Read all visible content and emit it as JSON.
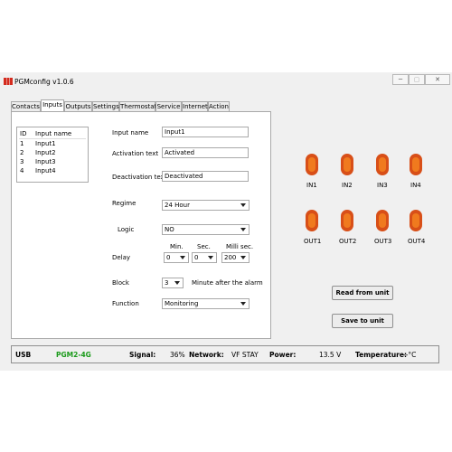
{
  "window": {
    "title": "PGMconfig v1.0.6"
  },
  "tabs": [
    "Contacts",
    "Inputs",
    "Outputs",
    "Settings",
    "Thermostat",
    "Service",
    "Internet",
    "Action"
  ],
  "inputs_list": {
    "col_id": "ID",
    "col_name": "Input name",
    "rows": [
      {
        "id": "1",
        "name": "Input1"
      },
      {
        "id": "2",
        "name": "Input2"
      },
      {
        "id": "3",
        "name": "Input3"
      },
      {
        "id": "4",
        "name": "Input4"
      }
    ]
  },
  "form": {
    "input_name_label": "Input name",
    "input_name_value": "Input1",
    "activation_label": "Activation text",
    "activation_value": "Activated",
    "deactivation_label": "Deactivation text",
    "deactivation_value": "Deactivated",
    "regime_label": "Regime",
    "regime_value": "24 Hour",
    "logic_label": "Logic",
    "logic_value": "NO",
    "delay_label": "Delay",
    "min_label": "Min.",
    "sec_label": "Sec.",
    "millisec_label": "Milli sec.",
    "delay_min": "0",
    "delay_sec": "0",
    "delay_ms": "200",
    "block_label": "Block",
    "block_value": "3",
    "block_suffix": "Minute after the alarm",
    "function_label": "Function",
    "function_value": "Monitoring"
  },
  "indicators": {
    "inputs": [
      "IN1",
      "IN2",
      "IN3",
      "IN4"
    ],
    "outputs": [
      "OUT1",
      "OUT2",
      "OUT3",
      "OUT4"
    ],
    "led_color": "#e8601c"
  },
  "buttons": {
    "read": "Read from unit",
    "save": "Save to unit"
  },
  "status": {
    "conn": "USB",
    "model": "PGM2-4G",
    "model_color": "#1a9a1a",
    "signal_label": "Signal:",
    "signal_value": "36%",
    "network_label": "Network:",
    "network_value": "VF STAY",
    "power_label": "Power:",
    "power_value": "13.5 V",
    "temp_label": "Temperature:",
    "temp_value": "--°C"
  }
}
